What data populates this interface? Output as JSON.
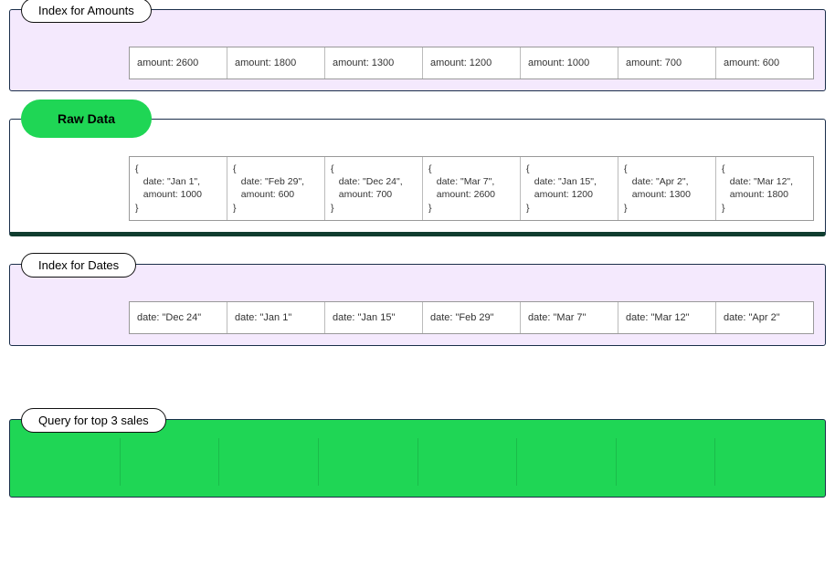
{
  "index_amounts": {
    "label": "Index for Amounts",
    "cells": [
      "amount: 2600",
      "amount: 1800",
      "amount: 1300",
      "amount: 1200",
      "amount: 1000",
      "amount: 700",
      "amount: 600"
    ]
  },
  "raw_data": {
    "label": "Raw Data",
    "cells": [
      "{\n   date: \"Jan 1\",\n   amount: 1000\n}",
      "{\n   date: \"Feb 29\",\n   amount: 600\n}",
      "{\n   date: \"Dec 24\",\n   amount: 700\n}",
      "{\n   date: \"Mar 7\",\n   amount: 2600\n}",
      "{\n   date: \"Jan 15\",\n   amount: 1200\n}",
      "{\n   date: \"Apr 2\",\n   amount: 1300\n}",
      "{\n   date: \"Mar 12\",\n   amount: 1800\n}"
    ]
  },
  "index_dates": {
    "label": "Index for Dates",
    "cells": [
      "date: \"Dec 24\"",
      "date: \"Jan 1\"",
      "date: \"Jan 15\"",
      "date: \"Feb 29\"",
      "date: \"Mar 7\"",
      "date: \"Mar 12\"",
      "date: \"Apr 2\""
    ]
  },
  "query": {
    "label": "Query for top 3 sales",
    "cell_count": 8
  }
}
